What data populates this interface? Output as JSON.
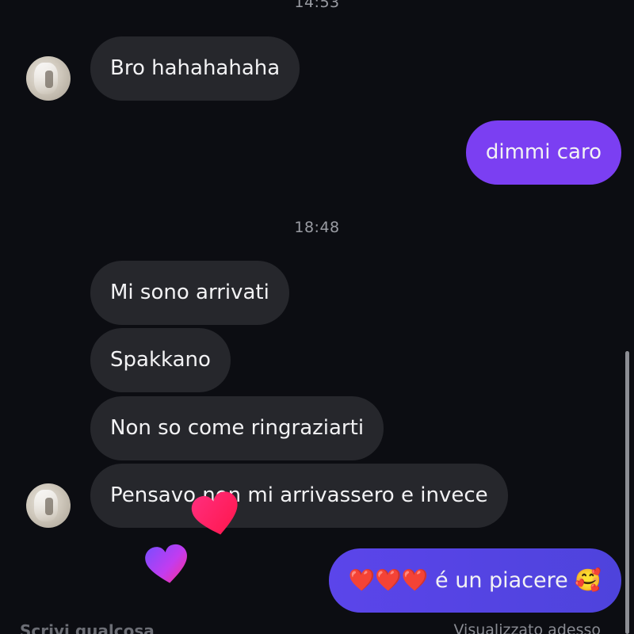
{
  "timestamps": {
    "top": "14:53",
    "middle": "18:48"
  },
  "messages": [
    {
      "text": "Bro hahahahaha",
      "sender": "other"
    },
    {
      "text": "dimmi caro",
      "sender": "me"
    },
    {
      "text": "Mi sono arrivati",
      "sender": "other"
    },
    {
      "text": "Spakkano",
      "sender": "other"
    },
    {
      "text": "Non so come ringraziarti",
      "sender": "other"
    },
    {
      "text": "Pensavo non mi arrivassero e invece",
      "sender": "other"
    },
    {
      "text": "❤️❤️❤️ é un piacere 🥰",
      "sender": "me"
    }
  ],
  "composer": {
    "placeholder": "Scrivi qualcosa"
  },
  "status": {
    "seen": "Visualizzato adesso"
  },
  "icons": {
    "avatar": "contact-avatar",
    "reaction": "heart-icon"
  },
  "colors": {
    "background": "#0c0d12",
    "incoming_bubble": "#26272c",
    "outgoing_bubble": "#7b3ff2",
    "outgoing_bubble_last": "#5b45ea",
    "timestamp": "#9a9ca3"
  }
}
